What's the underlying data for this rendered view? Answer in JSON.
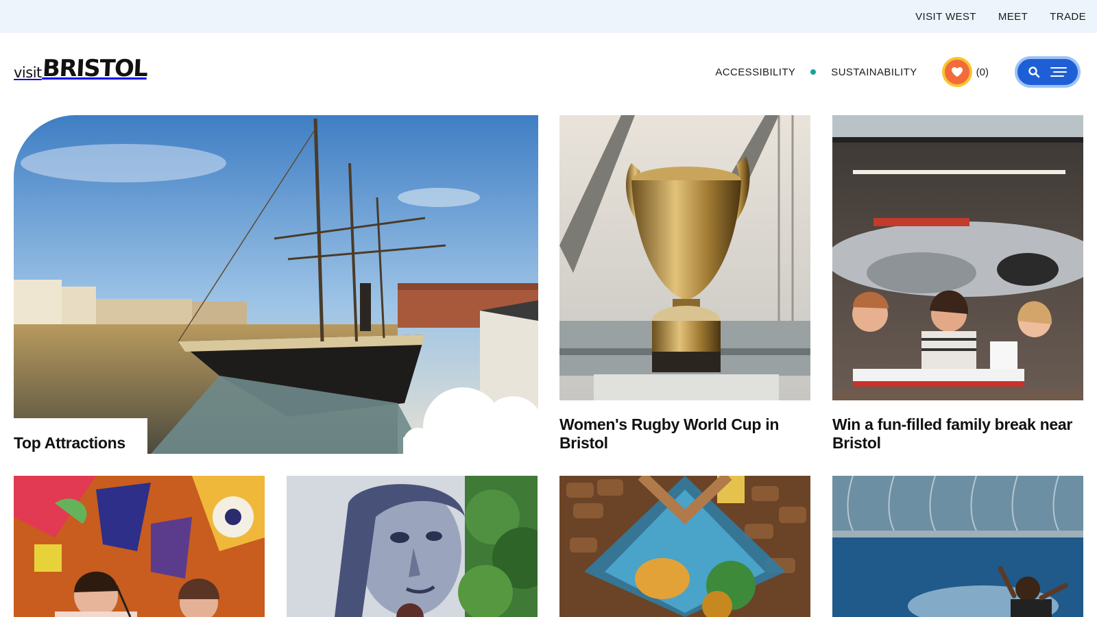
{
  "utility_nav": {
    "links": [
      "VISIT WEST",
      "MEET",
      "TRADE"
    ]
  },
  "header": {
    "logo": {
      "visit": "visit",
      "brand": "BRISTOL"
    },
    "nav": {
      "accessibility": "ACCESSIBILITY",
      "sustainability": "SUSTAINABILITY"
    },
    "favourites": {
      "count": "(0)",
      "icon": "heart-icon"
    },
    "menu": {
      "search_icon": "search-icon",
      "menu_icon": "hamburger-icon"
    }
  },
  "cards": {
    "featured": {
      "title": "Top Attractions",
      "image": "ss-great-britain-ship-photo"
    },
    "rugby": {
      "title": "Women's Rugby World Cup in Bristol",
      "image": "rugby-trophy-photo"
    },
    "family": {
      "title": "Win a fun-filled family break near Bristol",
      "image": "museum-children-photo"
    },
    "row2": [
      {
        "image": "mural-musicians-photo"
      },
      {
        "image": "street-art-portrait-photo"
      },
      {
        "image": "restaurant-interior-photo"
      },
      {
        "image": "swimmer-photo"
      }
    ]
  },
  "colors": {
    "utility_bg": "#eef4fb",
    "accent_teal": "#1aa39a",
    "favourite_orange": "#f26b3a",
    "favourite_ring": "#f7c531",
    "menu_blue": "#1f5fd6",
    "menu_ring": "#9ec3f5"
  }
}
